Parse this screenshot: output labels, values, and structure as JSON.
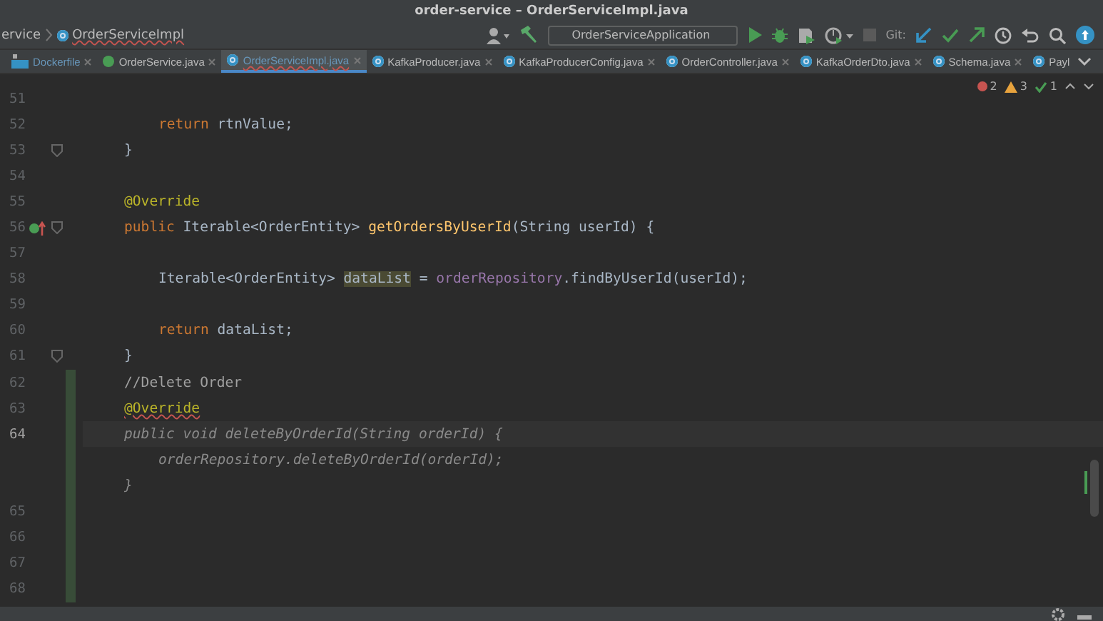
{
  "window": {
    "title": "order-service – OrderServiceImpl.java"
  },
  "breadcrumb": [
    {
      "label": "ervice",
      "kind": "folder"
    },
    {
      "label": "OrderServiceImpl",
      "kind": "class"
    }
  ],
  "toolbar": {
    "run_config": "OrderServiceApplication",
    "git_label": "Git:"
  },
  "tabs": [
    {
      "label": "Dockerfile",
      "kind": "docker",
      "selected": false
    },
    {
      "label": "OrderService.java",
      "kind": "interface",
      "selected": false
    },
    {
      "label": "OrderServiceImpl.java",
      "kind": "class",
      "selected": true
    },
    {
      "label": "KafkaProducer.java",
      "kind": "class",
      "selected": false
    },
    {
      "label": "KafkaProducerConfig.java",
      "kind": "class",
      "selected": false
    },
    {
      "label": "OrderController.java",
      "kind": "class",
      "selected": false
    },
    {
      "label": "KafkaOrderDto.java",
      "kind": "class",
      "selected": false
    },
    {
      "label": "Schema.java",
      "kind": "class",
      "selected": false
    },
    {
      "label": "Payl",
      "kind": "class",
      "selected": false
    }
  ],
  "inspections": {
    "errors": "2",
    "warnings": "3",
    "typos": "1"
  },
  "lines": [
    {
      "number": "51",
      "current": false,
      "changed": false,
      "fold": false,
      "override": false
    },
    {
      "number": "52",
      "current": false,
      "changed": false,
      "fold": false,
      "override": false,
      "kind": "body",
      "tokens": [
        {
          "t": "return",
          "kind": "kw"
        },
        {
          "t": " rtnValue;",
          "kind": "plain"
        }
      ]
    },
    {
      "number": "53",
      "current": false,
      "changed": false,
      "fold": true,
      "override": false,
      "kind": "member",
      "tokens": [
        {
          "t": "}",
          "kind": "plain"
        }
      ]
    },
    {
      "number": "54",
      "current": false,
      "changed": false,
      "fold": false,
      "override": false
    },
    {
      "number": "55",
      "current": false,
      "changed": false,
      "fold": false,
      "override": false,
      "kind": "member",
      "tokens": [
        {
          "t": "@Override",
          "kind": "ann"
        }
      ]
    },
    {
      "number": "56",
      "current": false,
      "changed": false,
      "fold": true,
      "override": true,
      "kind": "member",
      "tokens": [
        {
          "t": "public",
          "kind": "kw"
        },
        {
          "t": " Iterable<OrderEntity> ",
          "kind": "plain"
        },
        {
          "t": "getOrdersByUserId",
          "kind": "fn"
        },
        {
          "t": "(String userId) {",
          "kind": "plain"
        }
      ]
    },
    {
      "number": "57",
      "current": false,
      "changed": false,
      "fold": false,
      "override": false
    },
    {
      "number": "58",
      "current": false,
      "changed": false,
      "fold": false,
      "override": false,
      "kind": "body",
      "tokens": [
        {
          "t": "Iterable<OrderEntity> ",
          "kind": "plain"
        },
        {
          "t": "dataList",
          "kind": "hl"
        },
        {
          "t": " = ",
          "kind": "plain"
        },
        {
          "t": "orderRepository",
          "kind": "field"
        },
        {
          "t": ".findByUserId(userId);",
          "kind": "plain"
        }
      ]
    },
    {
      "number": "59",
      "current": false,
      "changed": false,
      "fold": false,
      "override": false
    },
    {
      "number": "60",
      "current": false,
      "changed": false,
      "fold": false,
      "override": false,
      "kind": "body",
      "tokens": [
        {
          "t": "return",
          "kind": "kw"
        },
        {
          "t": " dataList;",
          "kind": "plain"
        }
      ]
    },
    {
      "number": "61",
      "current": false,
      "changed": false,
      "fold": true,
      "override": false,
      "kind": "member",
      "tokens": [
        {
          "t": "}",
          "kind": "plain"
        }
      ]
    },
    {
      "number": "62",
      "current": false,
      "changed": true,
      "fold": false,
      "override": false,
      "kind": "member",
      "tokens": [
        {
          "t": "//Delete Order",
          "kind": "comment"
        }
      ]
    },
    {
      "number": "63",
      "current": false,
      "changed": true,
      "fold": false,
      "override": false,
      "kind": "member",
      "tokens": [
        {
          "t": "@Override",
          "kind": "annerr"
        }
      ]
    },
    {
      "number": "64",
      "current": true,
      "changed": true,
      "fold": false,
      "override": false,
      "kind": "member",
      "tokens": [
        {
          "t": "public void deleteByOrderId(String orderId) {",
          "kind": "dim"
        }
      ]
    },
    {
      "current": false,
      "changed": true,
      "fold": false,
      "override": false,
      "kind": "body",
      "tokens": [
        {
          "t": "orderRepository.deleteByOrderId(orderId);",
          "kind": "dim"
        }
      ]
    },
    {
      "current": false,
      "changed": true,
      "fold": false,
      "override": false,
      "kind": "member",
      "tokens": [
        {
          "t": "}",
          "kind": "dim"
        }
      ]
    },
    {
      "number": "65",
      "current": false,
      "changed": true,
      "fold": false,
      "override": false
    },
    {
      "number": "66",
      "current": false,
      "changed": true,
      "fold": false,
      "override": false
    },
    {
      "number": "67",
      "current": false,
      "changed": true,
      "fold": false,
      "override": false
    },
    {
      "number": "68",
      "current": false,
      "changed": true,
      "fold": false,
      "override": false
    }
  ]
}
